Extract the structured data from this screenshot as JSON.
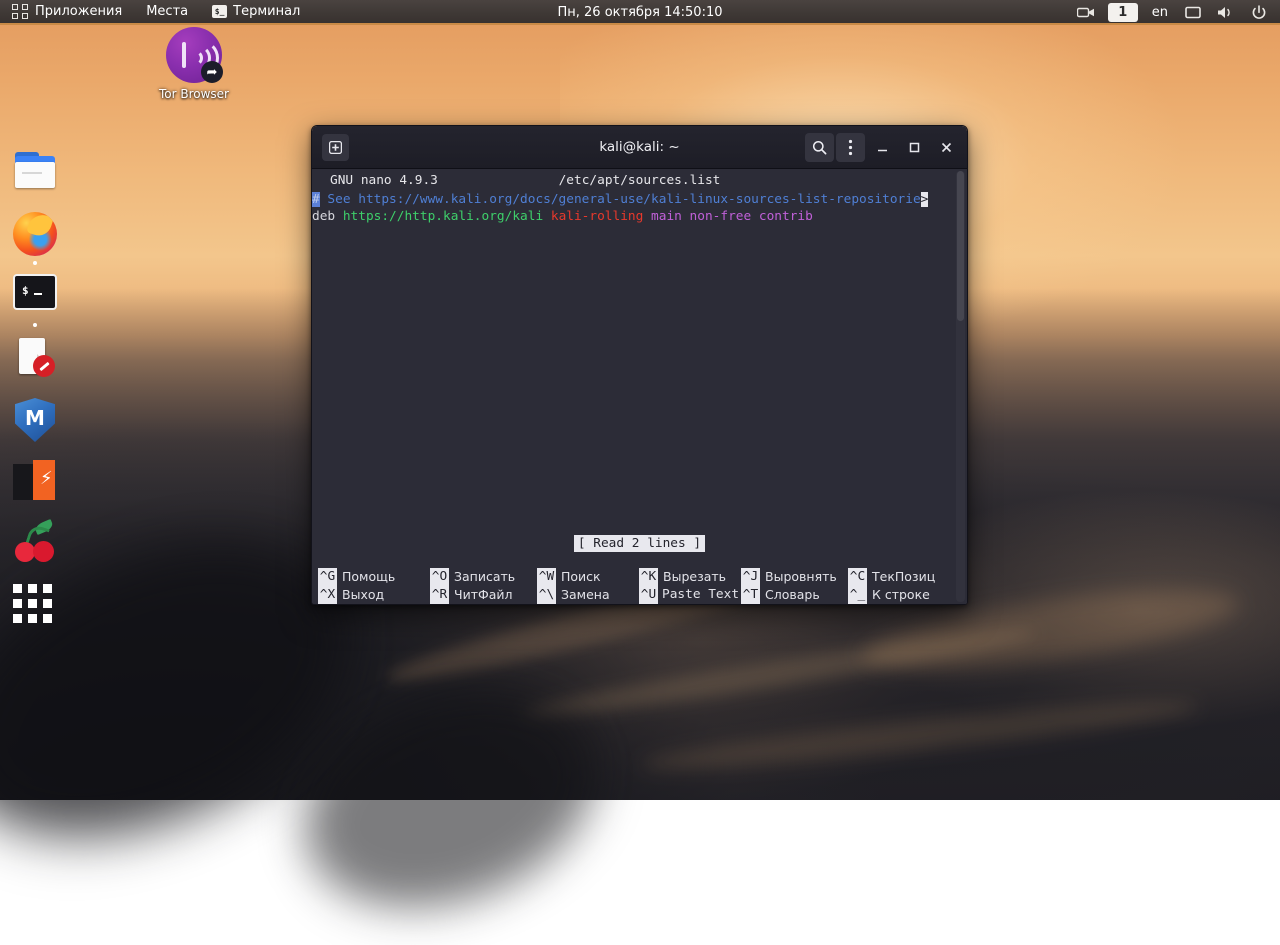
{
  "panel": {
    "apps_label": "Приложения",
    "places_label": "Места",
    "terminal_label": "Терминал",
    "terminal_icon": "terminal-icon",
    "apps_icon": "apps-grid-icon",
    "clock": "Пн, 26 октября  14:50:10",
    "tray": {
      "screencast_icon": "screencast-icon",
      "workspace": "1",
      "language": "en",
      "display_icon": "display-icon",
      "volume_icon": "volume-icon",
      "power_icon": "power-icon"
    }
  },
  "desktop": {
    "icons": [
      {
        "name": "tor-browser",
        "label": "Tor Browser"
      }
    ]
  },
  "dock": {
    "items": [
      {
        "name": "files",
        "label": "Files",
        "running": false
      },
      {
        "name": "firefox",
        "label": "Firefox ESR",
        "running": true
      },
      {
        "name": "terminal",
        "label": "Terminal",
        "running": true
      },
      {
        "name": "text-editor",
        "label": "Text Editor",
        "running": false
      },
      {
        "name": "metasploit",
        "label": "Metasploit",
        "running": false
      },
      {
        "name": "burpsuite",
        "label": "Burp Suite",
        "running": false
      },
      {
        "name": "cherrytree",
        "label": "CherryTree",
        "running": false
      },
      {
        "name": "show-apps",
        "label": "Show Applications",
        "running": false
      }
    ]
  },
  "terminal": {
    "title": "kali@kali: ~",
    "titlebar": {
      "new_tab_icon": "new-tab-icon",
      "search_icon": "search-icon",
      "menu_icon": "kebab-menu-icon",
      "minimize_icon": "minimize-icon",
      "maximize_icon": "maximize-icon",
      "close_icon": "close-icon"
    },
    "background": "#2c2c37"
  },
  "nano": {
    "version": "GNU nano 4.9.3",
    "filename": "/etc/apt/sources.list",
    "status_message": "[ Read 2 lines ]",
    "continuation_marker": ">",
    "lines": [
      {
        "segments": [
          {
            "text": "#",
            "color": "cursor"
          },
          {
            "text": " See https://www.kali.org/docs/general-use/kali-linux-sources-list-repositorie",
            "color": "comment"
          },
          {
            "text": ">",
            "color": "continuation"
          }
        ]
      },
      {
        "segments": [
          {
            "text": "deb ",
            "color": "white"
          },
          {
            "text": "https://http.kali.org/kali ",
            "color": "green"
          },
          {
            "text": "kali-rolling ",
            "color": "red"
          },
          {
            "text": "main non-free contrib",
            "color": "magenta"
          }
        ]
      }
    ],
    "shortcuts": [
      {
        "key": "^G",
        "label": "Помощь",
        "key2": "^X",
        "label2": "Выход"
      },
      {
        "key": "^O",
        "label": "Записать",
        "key2": "^R",
        "label2": "ЧитФайл"
      },
      {
        "key": "^W",
        "label": "Поиск",
        "key2": "^\\",
        "label2": "Замена"
      },
      {
        "key": "^K",
        "label": "Вырезать",
        "key2": "^U",
        "label2": "Paste Text"
      },
      {
        "key": "^J",
        "label": "Выровнять",
        "key2": "^T",
        "label2": "Словарь"
      },
      {
        "key": "^C",
        "label": "ТекПозиц",
        "key2": "^_",
        "label2": "К строке"
      }
    ]
  },
  "colors": {
    "panel_bg": "#3f3936",
    "panel_accent": "#c98a46",
    "term_bg": "#2c2c37",
    "titlebar_bg": "#1d1d26",
    "nano_comment": "#4f7fd4",
    "nano_green": "#3ecf6a",
    "nano_red": "#e8392c",
    "nano_magenta": "#c060d8",
    "nano_inverse_bg": "#e8e8ee"
  }
}
